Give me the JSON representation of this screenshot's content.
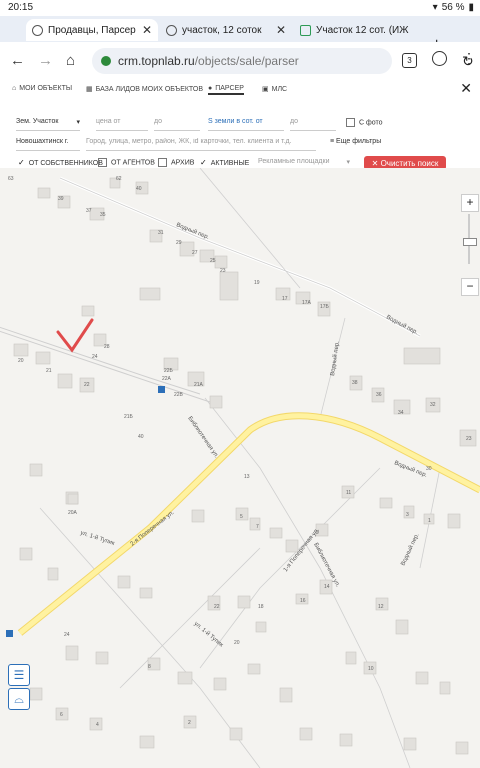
{
  "status_bar": {
    "time": "20:15",
    "battery": "56 %"
  },
  "browser": {
    "tabs": [
      {
        "title": "Продавцы, Парсер",
        "active": true
      },
      {
        "title": "участок, 12 соток",
        "active": false
      },
      {
        "title": "Участок 12 сот. (ИЖ",
        "active": false
      }
    ],
    "tab_count": "3",
    "address": {
      "domain": "crm.topnlab.ru",
      "path": "/objects/sale/parser"
    }
  },
  "nav": {
    "items": [
      {
        "label": "Мои объекты"
      },
      {
        "label": "База лидов моих объектов"
      },
      {
        "label": "Парсер",
        "active": true
      },
      {
        "label": "МЛС"
      }
    ]
  },
  "filters": {
    "category": "Зем. Участок",
    "price_from_placeholder": "цена от",
    "price_to_placeholder": "до",
    "land_area_label": "S земли в сот. от",
    "land_area_to_placeholder": "до",
    "photo_label": "С фото",
    "city": "Новошахтинск г.",
    "search_placeholder": "Город, улица, метро, район, ЖК, id карточки, тел. клиента и т.д.",
    "more_filters": "Еще фильтры",
    "from_owners": "От собственников",
    "from_agents": "От агентов",
    "archive": "Архив",
    "active": "Активные",
    "ad_platforms": "Рекламные площадки",
    "clear_button": "Очистить поиск"
  },
  "map": {
    "streets": [
      {
        "name": "Водный пер."
      },
      {
        "name": "Водный пер."
      },
      {
        "name": "Водный пер."
      },
      {
        "name": "Водный пер."
      },
      {
        "name": "Библиотечная ул."
      },
      {
        "name": "2-я Поперечная ул."
      },
      {
        "name": "Водный пер."
      },
      {
        "name": "ул. 1-й Тупик"
      },
      {
        "name": "1-я Поперечная ул."
      },
      {
        "name": "Библиотечная ул."
      },
      {
        "name": "ул. 1-й Тупик"
      }
    ],
    "house_numbers": [
      "63",
      "62",
      "40",
      "39",
      "37",
      "35",
      "31",
      "29",
      "27",
      "25",
      "23",
      "19",
      "17",
      "17А",
      "17Б",
      "28",
      "24",
      "21",
      "20",
      "22",
      "22Б",
      "22В",
      "22А",
      "21А",
      "21Б",
      "40",
      "38",
      "36",
      "34",
      "32",
      "30",
      "23",
      "20А",
      "13",
      "11",
      "9",
      "7",
      "5",
      "3",
      "1",
      "24",
      "22",
      "20",
      "18",
      "16",
      "14",
      "12",
      "10",
      "8",
      "6",
      "4",
      "2"
    ],
    "colors": {
      "background": "#f4f3f0",
      "main_road": "#fff2a0",
      "building": "#e2e0dc",
      "checkmark": "#e04b4b"
    }
  },
  "colors": {
    "accent": "#e04b4b",
    "link": "#2c6fb8"
  }
}
